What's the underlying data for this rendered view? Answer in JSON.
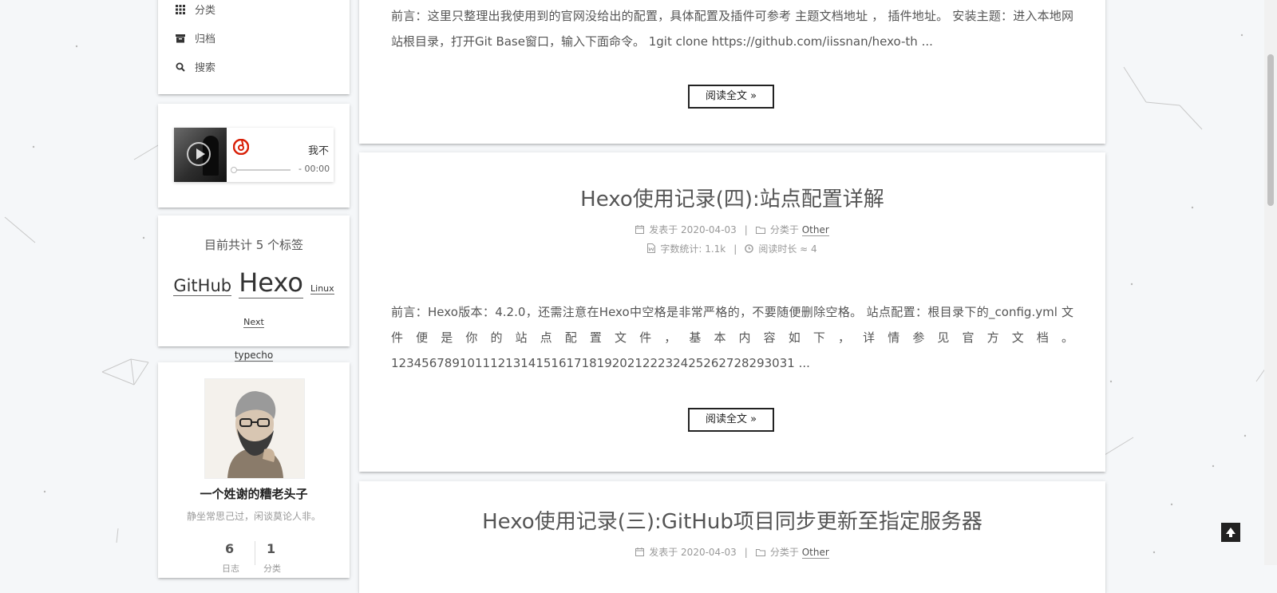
{
  "sidebar": {
    "menu": [
      {
        "label": "分类",
        "icon": "grid-icon"
      },
      {
        "label": "归档",
        "icon": "archive-icon"
      },
      {
        "label": "搜索",
        "icon": "search-icon"
      }
    ],
    "player": {
      "title": "我不",
      "time": "- 00:00",
      "progress": 0
    },
    "tags": {
      "count_text": "目前共计 5 个标签",
      "items": [
        "GitHub",
        "Hexo",
        "Linux",
        "Next",
        "typecho"
      ]
    },
    "author": {
      "name": "一个姓谢的糟老头子",
      "motto": "静坐常思己过，闲谈莫论人非。",
      "stats": [
        {
          "value": "6",
          "label": "日志"
        },
        {
          "value": "1",
          "label": "分类"
        }
      ]
    }
  },
  "posts": [
    {
      "excerpt": "前言：这里只整理出我使用到的官网没给出的配置，具体配置及插件可参考 主题文档地址 ， 插件地址。 安装主题：进入本地网站根目录，打开Git Base窗口，输入下面命令。 1git clone https://github.com/iissnan/hexo-th ...",
      "read_more": "阅读全文 »"
    },
    {
      "title": "Hexo使用记录(四):站点配置详解",
      "posted": "发表于 2020-04-03",
      "category_prefix": "分类于",
      "category": "Other",
      "words": "字数统计: 1.1k",
      "reading": "阅读时长 ≈ 4",
      "excerpt": "前言：Hexo版本：4.2.0，还需注意在Hexo中空格是非常严格的，不要随便删除空格。 站点配置：根目录下的_config.yml 文 件 便 是 你 的 站 点 配 置 文 件 ， 基 本 内 容 如 下 ， 详 情 参 见  官 方 文 档  。 12345678910111213141516171819202122232425262728293031 ...",
      "read_more": "阅读全文 »"
    },
    {
      "title": "Hexo使用记录(三):GitHub项目同步更新至指定服务器",
      "posted": "发表于 2020-04-03",
      "category_prefix": "分类于",
      "category": "Other"
    }
  ],
  "colors": {
    "background": "#f5f7f9",
    "card": "#ffffff",
    "text": "#555555",
    "netease_red": "#d81e06"
  }
}
